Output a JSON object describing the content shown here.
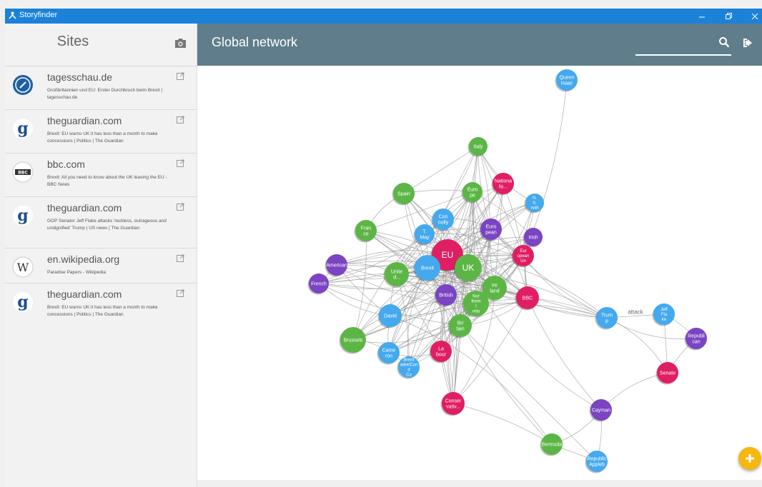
{
  "app": {
    "title": "Storyfinder"
  },
  "sidebar": {
    "title": "Sites",
    "sites": [
      {
        "domain": "tagesschau.de",
        "description": "Großbritannien und EU: Erster Durchbruch beim Brexit | tagesschau.de",
        "icon": "tagesschau-logo-icon"
      },
      {
        "domain": "theguardian.com",
        "description": "Brexit: EU warns UK it has less than a month to make concessions | Politics | The Guardian",
        "icon": "guardian-logo-icon"
      },
      {
        "domain": "bbc.com",
        "description": "Brexit: All you need to know about the UK leaving the EU - BBC News",
        "icon": "bbc-logo-icon",
        "logo_text": "BBC"
      },
      {
        "domain": "theguardian.com",
        "description": "GOP Senator Jeff Flake attacks 'reckless, outrageous and undignified' Trump | US news | The Guardian",
        "icon": "guardian-logo-icon"
      },
      {
        "domain": "en.wikipedia.org",
        "description": "Paradise Papers - Wikipedia",
        "icon": "wikipedia-logo-icon",
        "logo_text": "W"
      },
      {
        "domain": "theguardian.com",
        "description": "Brexit: EU warns UK it has less than a month to make concessions | Politics | The Guardian",
        "icon": "guardian-logo-icon"
      }
    ]
  },
  "main": {
    "title": "Global network"
  },
  "colors": {
    "green": "#5cb646",
    "blue": "#44a9ee",
    "pink": "#e01e63",
    "purple": "#7a44c2",
    "edge": "#9a9a9a"
  },
  "graph": {
    "nodes": [
      {
        "id": "queen",
        "label": "Queen Isaac",
        "color": "blue"
      },
      {
        "id": "italy",
        "label": "Italy",
        "color": "green"
      },
      {
        "id": "nationalists",
        "label": "Nationa lis...",
        "color": "pink"
      },
      {
        "id": "europe",
        "label": "Euro pe",
        "color": "green"
      },
      {
        "id": "nsmith",
        "label": "N. S. mith",
        "color": "blue"
      },
      {
        "id": "spain",
        "label": "Spain",
        "color": "green"
      },
      {
        "id": "connolly",
        "label": "Con nolly",
        "color": "blue"
      },
      {
        "id": "france",
        "label": "Fran ce",
        "color": "green"
      },
      {
        "id": "tmay",
        "label": "T. May",
        "color": "blue"
      },
      {
        "id": "european1",
        "label": "Euro pean",
        "color": "purple"
      },
      {
        "id": "irish",
        "label": "Irish",
        "color": "purple"
      },
      {
        "id": "eu",
        "label": "EU",
        "color": "pink"
      },
      {
        "id": "european2",
        "label": "Eur opean Un",
        "color": "pink"
      },
      {
        "id": "american",
        "label": "American",
        "color": "purple"
      },
      {
        "id": "brexit",
        "label": "Brexit",
        "color": "blue"
      },
      {
        "id": "uk",
        "label": "UK",
        "color": "green"
      },
      {
        "id": "united",
        "label": "Unite d...",
        "color": "green"
      },
      {
        "id": "french",
        "label": "French",
        "color": "purple"
      },
      {
        "id": "ireland",
        "label": "Ire land",
        "color": "green"
      },
      {
        "id": "british",
        "label": "British",
        "color": "purple"
      },
      {
        "id": "bbc",
        "label": "BBC",
        "color": "pink"
      },
      {
        "id": "northern",
        "label": "Nor them I rela",
        "color": "green"
      },
      {
        "id": "david",
        "label": "David",
        "color": "blue"
      },
      {
        "id": "trump",
        "label": "Trum p",
        "color": "blue"
      },
      {
        "id": "flake",
        "label": "Jeff Fla ke",
        "color": "blue"
      },
      {
        "id": "britain",
        "label": "Bri tain",
        "color": "green"
      },
      {
        "id": "republican",
        "label": "Republi can",
        "color": "purple"
      },
      {
        "id": "brussels",
        "label": "Brussels",
        "color": "green"
      },
      {
        "id": "labour",
        "label": "La bour",
        "color": "pink"
      },
      {
        "id": "cameron",
        "label": "Came ron",
        "color": "blue"
      },
      {
        "id": "brexitcomm",
        "label": "Brexit ader/Con d Co",
        "color": "blue"
      },
      {
        "id": "senate",
        "label": "Senate",
        "color": "pink"
      },
      {
        "id": "conservative",
        "label": "Conser vativ...",
        "color": "pink"
      },
      {
        "id": "cayman",
        "label": "Cayman",
        "color": "purple"
      },
      {
        "id": "bermuda",
        "label": "Bermuda",
        "color": "green"
      },
      {
        "id": "appleby",
        "label": "Republic Appleb",
        "color": "blue"
      }
    ],
    "edge_labels": [
      {
        "from": "trump",
        "to": "flake",
        "label": "attack"
      }
    ]
  }
}
